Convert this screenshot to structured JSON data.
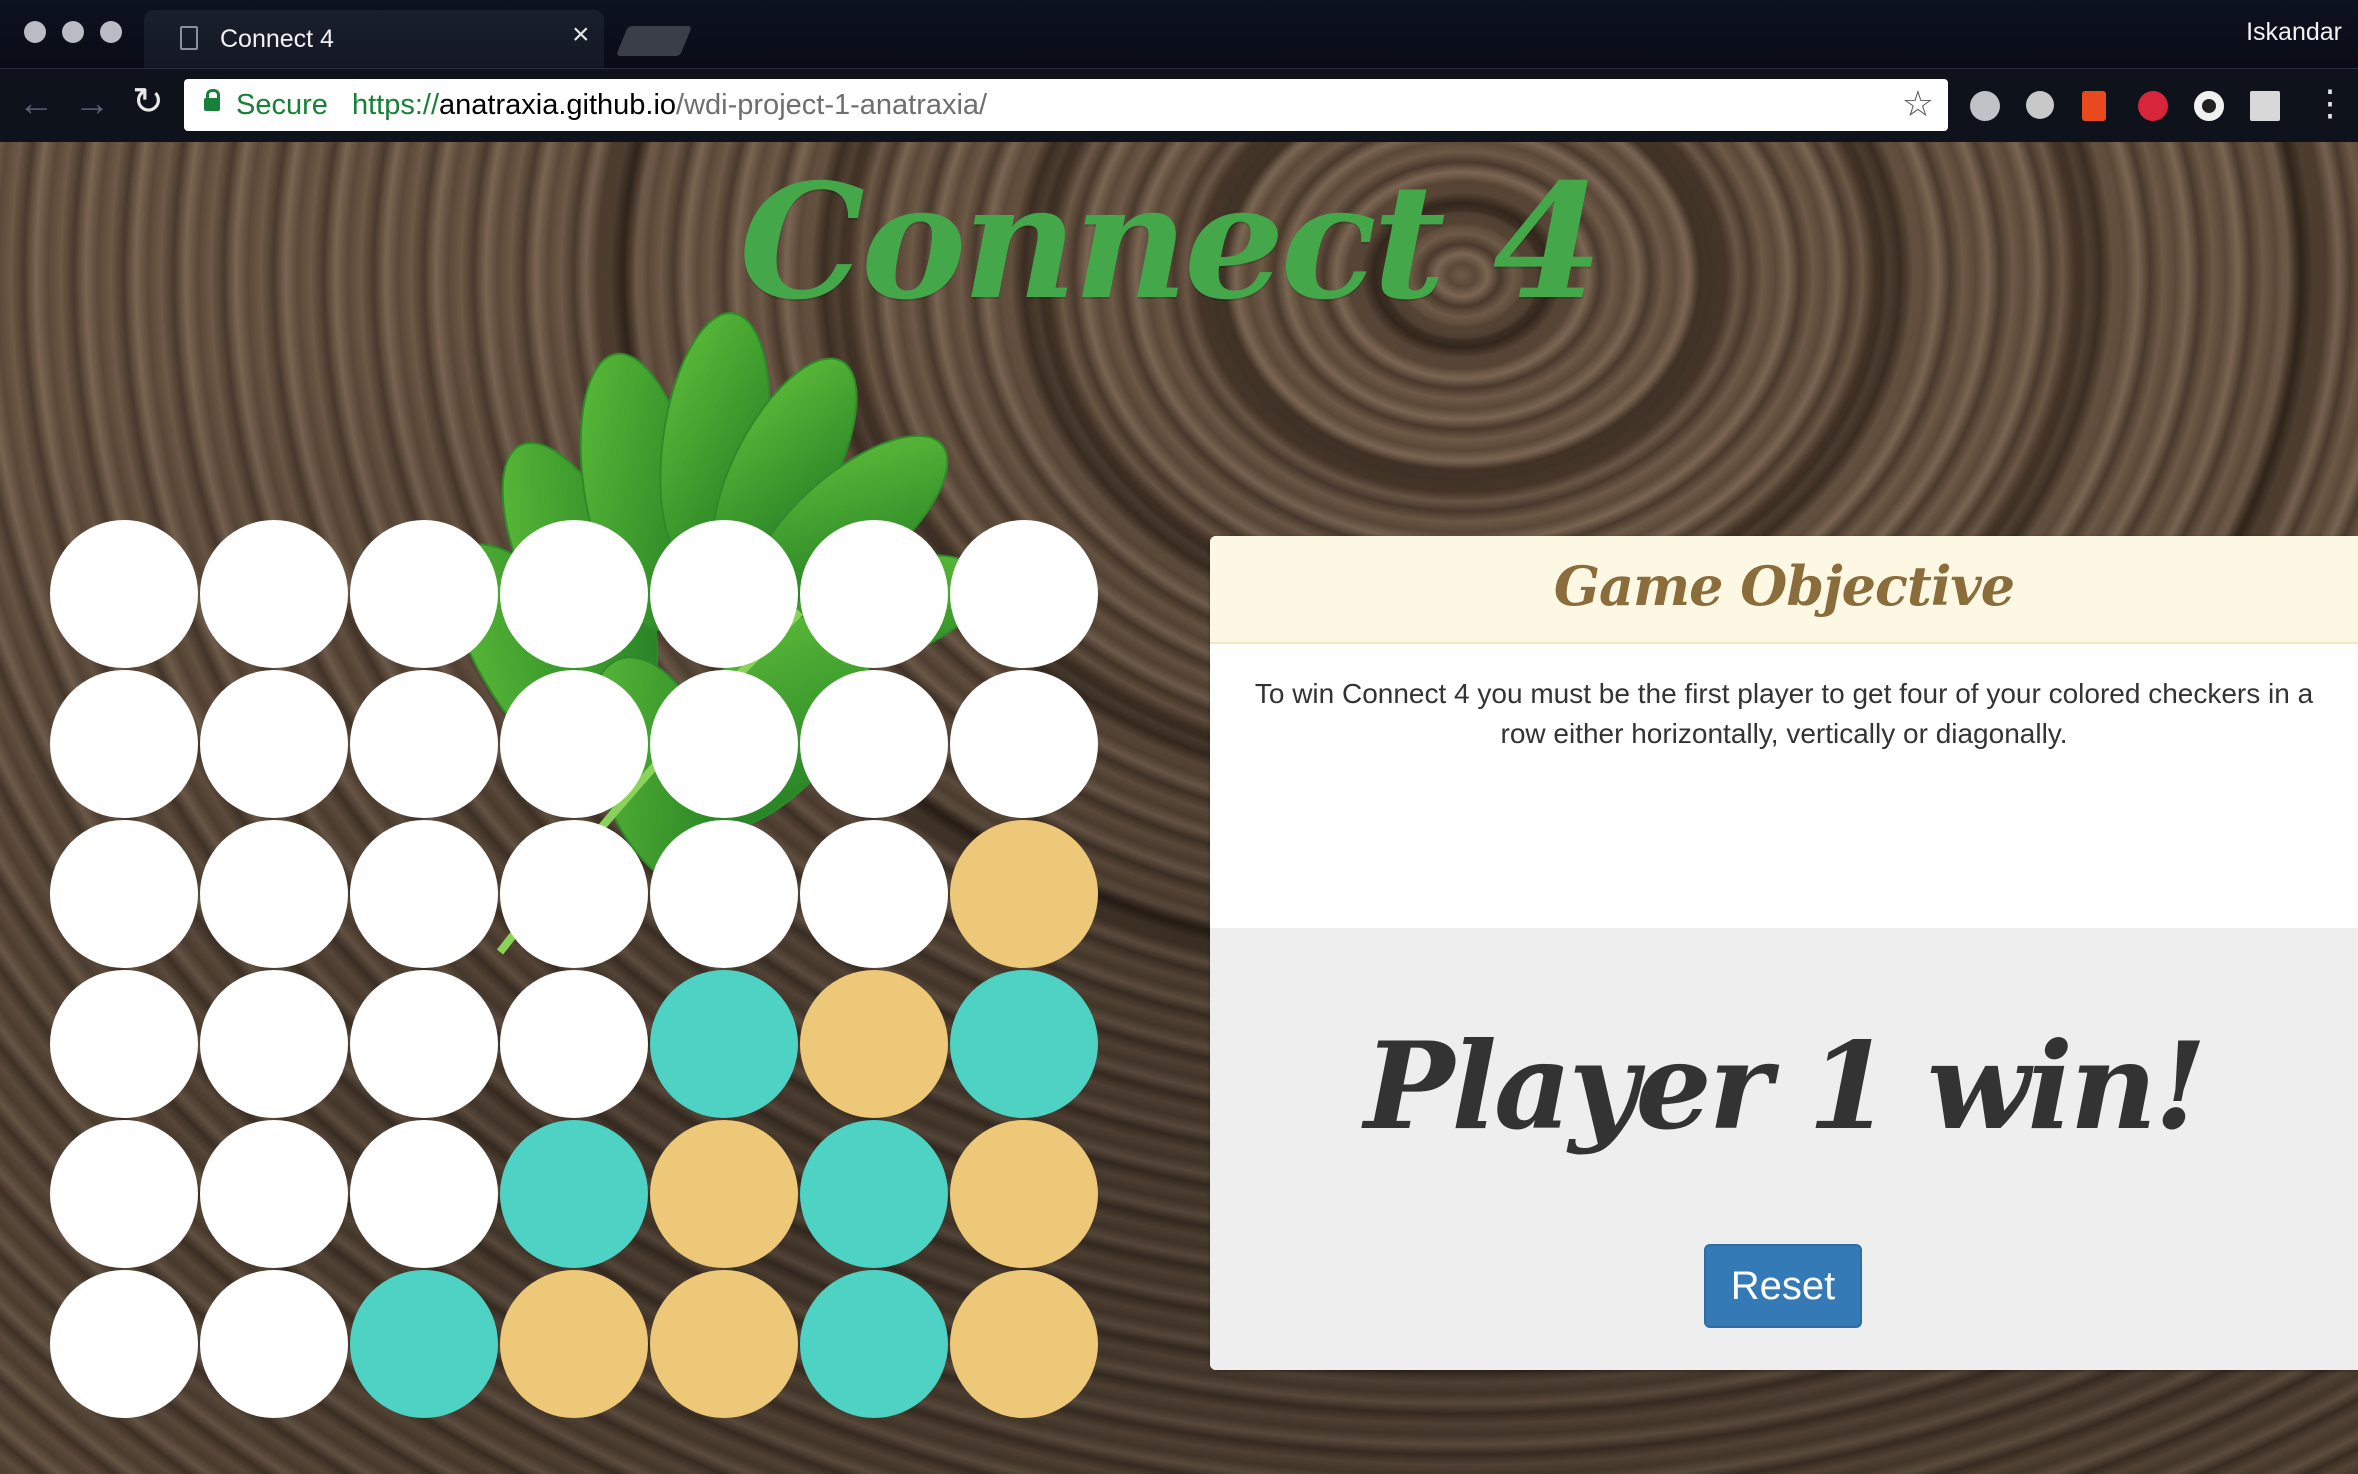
{
  "browser": {
    "tab_title": "Connect 4",
    "tab_close": "×",
    "profile_name": "Iskandar",
    "secure_label": "Secure",
    "url_scheme": "https://",
    "url_host": "anatraxia.github.io",
    "url_path": "/wdi-project-1-anatraxia/",
    "extensions": [
      "grey-circle-extension-icon",
      "skype-icon",
      "office-icon",
      "pinterest-icon",
      "dark-circle-extension-icon",
      "grid-extension-icon"
    ]
  },
  "page": {
    "title": "Connect 4",
    "objective": {
      "heading": "Game Objective",
      "text": "To win Connect 4 you must be the first player to get four of your colored checkers in a row either horizontally, vertically or diagonally."
    },
    "result": "Player 1 win!",
    "reset_label": "Reset"
  },
  "board": {
    "colors": {
      "empty": "#ffffff",
      "player1": "#ecc878",
      "player2": "#4dd2c4"
    },
    "columns": 7,
    "rows": [
      [
        "empty",
        "empty",
        "empty",
        "empty",
        "empty",
        "empty",
        "empty"
      ],
      [
        "empty",
        "empty",
        "empty",
        "empty",
        "empty",
        "empty",
        "empty"
      ],
      [
        "empty",
        "empty",
        "empty",
        "empty",
        "empty",
        "empty",
        "player1"
      ],
      [
        "empty",
        "empty",
        "empty",
        "empty",
        "player2",
        "player1",
        "player2"
      ],
      [
        "empty",
        "empty",
        "empty",
        "player2",
        "player1",
        "player2",
        "player1"
      ],
      [
        "empty",
        "empty",
        "player2",
        "player1",
        "player1",
        "player2",
        "player1"
      ]
    ]
  }
}
